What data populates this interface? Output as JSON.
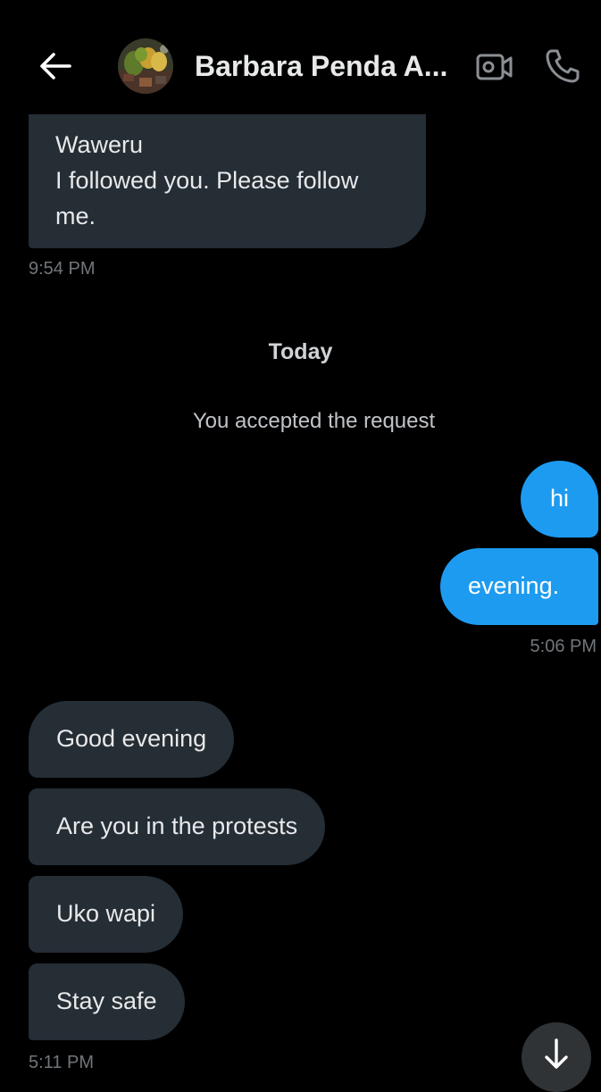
{
  "header": {
    "contact_name": "Barbara Penda A...",
    "back_icon": "arrow-left-icon",
    "video_icon": "video-camera-icon",
    "call_icon": "phone-icon"
  },
  "messages": {
    "first": {
      "text_line1": "Waweru",
      "text_line2": "I followed you. Please follow me.",
      "time": "9:54 PM"
    },
    "date_separator": "Today",
    "system_note": "You accepted the request",
    "outgoing": [
      {
        "text": "hi"
      },
      {
        "text": "evening."
      }
    ],
    "outgoing_time": "5:06 PM",
    "incoming": [
      {
        "text": "Good evening"
      },
      {
        "text": "Are you in the protests"
      },
      {
        "text": "Uko wapi"
      },
      {
        "text": "Stay safe"
      }
    ],
    "incoming_time": "5:11 PM"
  },
  "scroll_down_icon": "arrow-down-icon",
  "colors": {
    "background": "#000000",
    "incoming_bubble": "#252d35",
    "outgoing_bubble": "#1d9bf0",
    "timestamp": "#71767b"
  }
}
